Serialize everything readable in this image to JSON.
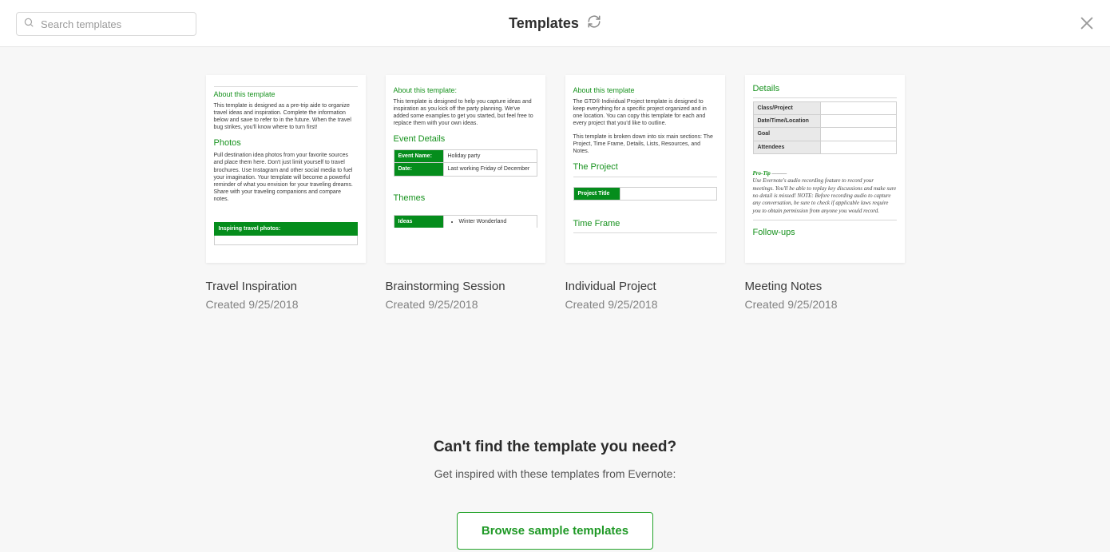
{
  "header": {
    "title": "Templates",
    "search_placeholder": "Search templates"
  },
  "templates": [
    {
      "title": "Travel Inspiration",
      "meta": "Created 9/25/2018",
      "preview": {
        "about_heading": "About this template",
        "about_text": "This template is designed as a pre-trip aide to organize travel ideas and inspiration.  Complete the information below and save to refer to in the future.  When the travel bug strikes, you'll know where to turn first!",
        "photos_heading": "Photos",
        "photos_text": "Pull destination idea photos from your favorite sources and place them here. Don't just limit yourself to travel brochures. Use Instagram and other social media to fuel your imagination. Your template will become a powerful reminder of what you envision for your traveling dreams. Share with your traveling companions and compare notes.",
        "bar_label": "Inspiring travel photos:"
      }
    },
    {
      "title": "Brainstorming Session",
      "meta": "Created 9/25/2018",
      "preview": {
        "about_heading": "About this template:",
        "about_text": "This template is designed to help you capture ideas and inspiration as you kick off the party planning. We've added some examples to get you started, but feel free to replace them with your own ideas.",
        "event_heading": "Event Details",
        "event_name_label": "Event Name:",
        "event_name_value": "Holiday party",
        "date_label": "Date:",
        "date_value": "Last working Friday of December",
        "themes_heading": "Themes",
        "ideas_label": "Ideas",
        "bullet1": "Winter Wonderland"
      }
    },
    {
      "title": "Individual Project",
      "meta": "Created 9/25/2018",
      "preview": {
        "about_heading": "About this template",
        "about_text1": "The GTD® Individual Project template is designed to keep everything for a specific project organized and in one location. You can copy this template for each and every project that you'd like to outline.",
        "about_text2": "This template is broken down into six main sections: The Project, Time Frame, Details, Lists, Resources, and Notes.",
        "project_heading": "The Project",
        "project_title_label": "Project Title",
        "timeframe_heading": "Time Frame"
      }
    },
    {
      "title": "Meeting Notes",
      "meta": "Created 9/25/2018",
      "preview": {
        "details_heading": "Details",
        "rows": {
          "r1": "Class/Project",
          "r2": "Date/Time/Location",
          "r3": "Goal",
          "r4": "Attendees"
        },
        "protip_label": "Pro-Tip",
        "protip_text": "Use Evernote's audio recording feature to record your meetings. You'll be able to replay key discussions and make sure no detail is missed! NOTE: Before recording audio to capture any conversation, be sure to check if applicable laws require you to obtain permission from anyone you would record.",
        "followups_heading": "Follow-ups"
      }
    }
  ],
  "footer": {
    "heading": "Can't find the template you need?",
    "sub": "Get inspired with these templates from Evernote:",
    "button": "Browse sample templates"
  }
}
